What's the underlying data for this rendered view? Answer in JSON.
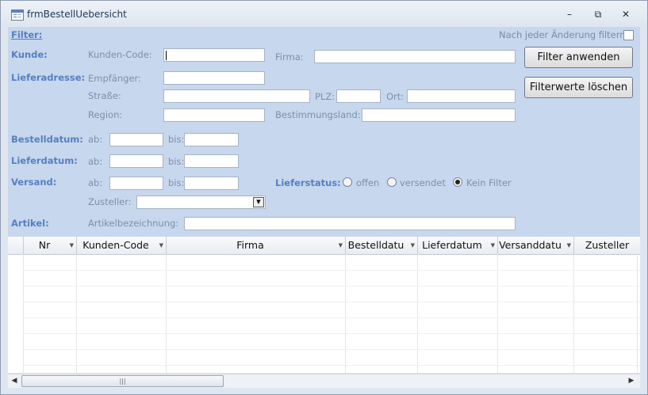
{
  "window": {
    "title": "frmBestellUebersicht"
  },
  "filter": {
    "heading": "Filter:",
    "auto_filter_label": "Nach jeder Änderung filtern",
    "kunde_section": "Kunde:",
    "kunden_code_label": "Kunden-Code:",
    "firma_label": "Firma:",
    "lieferadresse_section": "Lieferadresse:",
    "empfaenger_label": "Empfänger:",
    "strasse_label": "Straße:",
    "plz_label": "PLZ:",
    "ort_label": "Ort:",
    "region_label": "Region:",
    "bestimmungsland_label": "Bestimmungsland:",
    "bestelldatum_section": "Bestelldatum:",
    "lieferdatum_section": "Lieferdatum:",
    "versand_section": "Versand:",
    "ab_label": "ab:",
    "bis_label": "bis:",
    "zusteller_label": "Zusteller:",
    "lieferstatus_label": "Lieferstatus:",
    "status_offen": "offen",
    "status_versendet": "versendet",
    "status_kein_filter": "Kein Filter",
    "selected_status": "Kein Filter",
    "artikel_section": "Artikel:",
    "artikelbezeichnung_label": "Artikelbezeichnung:"
  },
  "buttons": {
    "apply": "Filter anwenden",
    "clear": "Filterwerte löschen"
  },
  "grid": {
    "columns": [
      "Nr",
      "Kunden-Code",
      "Firma",
      "Bestelldatu",
      "Lieferdatum",
      "Versanddatu",
      "Zusteller"
    ]
  }
}
